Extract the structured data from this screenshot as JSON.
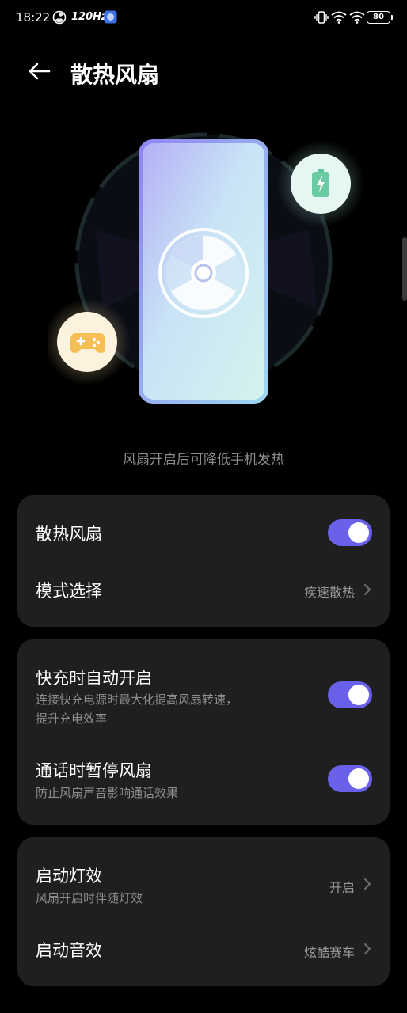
{
  "status_bar": {
    "time": "18:22",
    "refresh_rate": "120Hz",
    "battery": "80"
  },
  "header": {
    "title": "散热风扇"
  },
  "hero": {
    "caption": "风扇开启后可降低手机发热"
  },
  "card1": {
    "fan_toggle": {
      "label": "散热风扇",
      "on": true
    },
    "mode": {
      "label": "模式选择",
      "value": "疾速散热"
    }
  },
  "card2": {
    "fast_charge": {
      "label": "快充时自动开启",
      "sub1": "连接快充电源时最大化提高风扇转速，",
      "sub2": "提升充电效率",
      "on": true
    },
    "call_pause": {
      "label": "通话时暂停风扇",
      "sub": "防止风扇声音影响通话效果",
      "on": true
    }
  },
  "card3": {
    "light": {
      "label": "启动灯效",
      "sub": "风扇开启时伴随灯效",
      "value": "开启"
    },
    "sound": {
      "label": "启动音效",
      "value": "炫酷赛车"
    }
  },
  "colors": {
    "accent": "#6a61ea",
    "card_bg": "#1f1f1f",
    "background": "#000000"
  }
}
